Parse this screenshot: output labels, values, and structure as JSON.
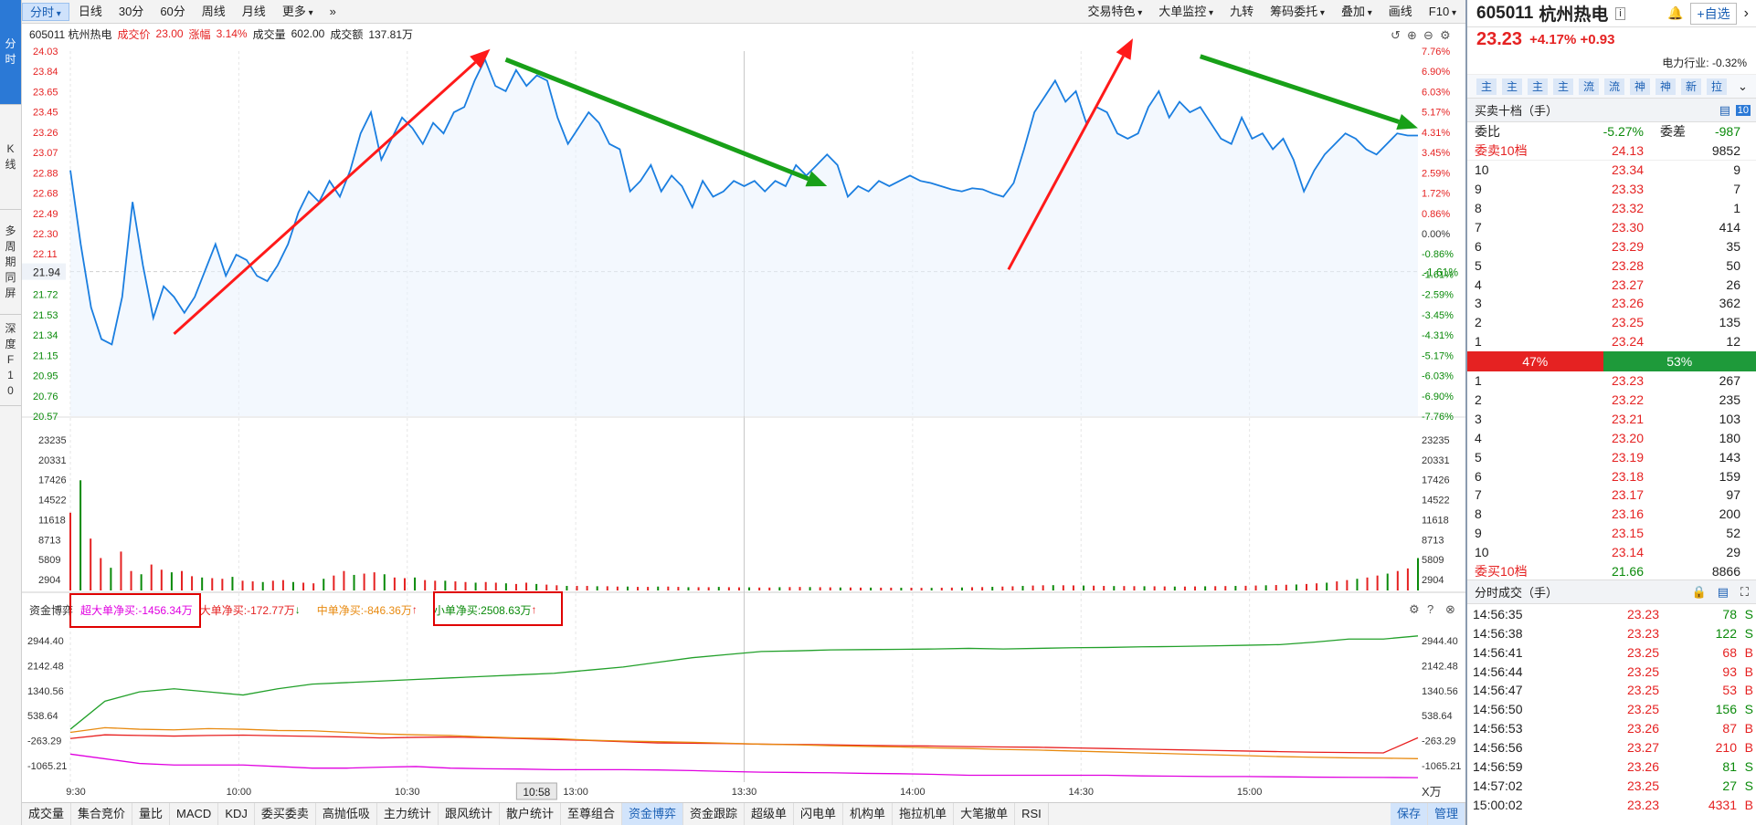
{
  "sidetabs": [
    "分时",
    "K线",
    "多周期同屏",
    "深度F10"
  ],
  "toolbar": {
    "collapse": "»",
    "items": [
      "分时",
      "日线",
      "30分",
      "60分",
      "周线",
      "月线",
      "更多"
    ],
    "right": [
      "交易特色",
      "大单监控",
      "九转",
      "筹码委托",
      "叠加",
      "画线",
      "F10"
    ]
  },
  "info": {
    "code_name": "605011 杭州热电",
    "price_label": "成交价",
    "price": "23.00",
    "change_label": "涨幅",
    "change": "3.14%",
    "vol_label": "成交量",
    "vol": "602.00",
    "amount_label": "成交额",
    "amount": "137.81万"
  },
  "capital_legend": {
    "label": "资金博弈",
    "super": "超大单净买:-1456.34万",
    "large": "大单净买:-172.77万",
    "medium": "中单净买:-846.36万",
    "small": "小单净买:2508.63万"
  },
  "unit_label": "X万",
  "crosshair_time": "10:58",
  "colors": {
    "up": "#e52222",
    "down": "#0a8a0a",
    "price_line": "#1a7ee0",
    "accent": "#2b79d6"
  },
  "chart_data": {
    "type": "line",
    "time_labels": [
      "9:30",
      "10:00",
      "10:30",
      "11:30/13:00",
      "13:30",
      "14:00",
      "14:30",
      "15:00"
    ],
    "prev_close": 21.94,
    "y_ticks_left": [
      "24.03",
      "23.84",
      "23.65",
      "23.45",
      "23.26",
      "23.07",
      "22.88",
      "22.68",
      "22.49",
      "22.30",
      "22.11",
      "21.94",
      "21.72",
      "21.53",
      "21.34",
      "21.15",
      "20.95",
      "20.76",
      "20.57"
    ],
    "y_ticks_right": [
      "7.76%",
      "6.90%",
      "6.03%",
      "5.17%",
      "4.31%",
      "3.45%",
      "2.59%",
      "1.72%",
      "0.86%",
      "0.00%",
      "-0.86%",
      "-1.61%",
      "-2.59%",
      "-3.45%",
      "-4.31%",
      "-5.17%",
      "-6.03%",
      "-6.90%",
      "-7.76%"
    ],
    "vol_ticks": [
      "23235",
      "20331",
      "17426",
      "14522",
      "11618",
      "8713",
      "5809",
      "2904"
    ],
    "cap_ticks": [
      "2944.40",
      "2142.48",
      "1340.56",
      "538.64",
      "-263.29",
      "-1065.21"
    ],
    "price_series": [
      [
        0,
        22.9
      ],
      [
        2,
        22.2
      ],
      [
        4,
        21.6
      ],
      [
        6,
        21.3
      ],
      [
        8,
        21.25
      ],
      [
        10,
        21.7
      ],
      [
        12,
        22.6
      ],
      [
        14,
        22.0
      ],
      [
        16,
        21.5
      ],
      [
        18,
        21.8
      ],
      [
        20,
        21.7
      ],
      [
        22,
        21.55
      ],
      [
        24,
        21.7
      ],
      [
        26,
        21.95
      ],
      [
        28,
        22.2
      ],
      [
        30,
        21.9
      ],
      [
        32,
        22.1
      ],
      [
        34,
        22.05
      ],
      [
        36,
        21.9
      ],
      [
        38,
        21.85
      ],
      [
        40,
        22.0
      ],
      [
        42,
        22.2
      ],
      [
        44,
        22.5
      ],
      [
        46,
        22.7
      ],
      [
        48,
        22.6
      ],
      [
        50,
        22.8
      ],
      [
        52,
        22.65
      ],
      [
        54,
        22.9
      ],
      [
        56,
        23.25
      ],
      [
        58,
        23.45
      ],
      [
        60,
        23.0
      ],
      [
        62,
        23.2
      ],
      [
        64,
        23.4
      ],
      [
        66,
        23.3
      ],
      [
        68,
        23.15
      ],
      [
        70,
        23.35
      ],
      [
        72,
        23.25
      ],
      [
        74,
        23.45
      ],
      [
        76,
        23.5
      ],
      [
        78,
        23.75
      ],
      [
        80,
        23.95
      ],
      [
        82,
        23.7
      ],
      [
        84,
        23.65
      ],
      [
        86,
        23.85
      ],
      [
        88,
        23.7
      ],
      [
        90,
        23.8
      ],
      [
        92,
        23.75
      ],
      [
        94,
        23.4
      ],
      [
        96,
        23.15
      ],
      [
        98,
        23.3
      ],
      [
        100,
        23.45
      ],
      [
        102,
        23.35
      ],
      [
        104,
        23.15
      ],
      [
        106,
        23.1
      ],
      [
        108,
        22.7
      ],
      [
        110,
        22.8
      ],
      [
        112,
        22.95
      ],
      [
        114,
        22.7
      ],
      [
        116,
        22.85
      ],
      [
        118,
        22.75
      ],
      [
        120,
        22.55
      ],
      [
        122,
        22.8
      ],
      [
        124,
        22.65
      ],
      [
        126,
        22.7
      ],
      [
        128,
        22.8
      ],
      [
        130,
        22.75
      ],
      [
        132,
        22.8
      ],
      [
        134,
        22.7
      ],
      [
        136,
        22.8
      ],
      [
        138,
        22.75
      ],
      [
        140,
        22.95
      ],
      [
        142,
        22.85
      ],
      [
        144,
        22.95
      ],
      [
        146,
        23.05
      ],
      [
        148,
        22.95
      ],
      [
        150,
        22.65
      ],
      [
        152,
        22.75
      ],
      [
        154,
        22.7
      ],
      [
        156,
        22.8
      ],
      [
        158,
        22.75
      ],
      [
        160,
        22.8
      ],
      [
        162,
        22.85
      ],
      [
        164,
        22.8
      ],
      [
        166,
        22.78
      ],
      [
        168,
        22.75
      ],
      [
        170,
        22.72
      ],
      [
        172,
        22.7
      ],
      [
        174,
        22.73
      ],
      [
        176,
        22.72
      ],
      [
        178,
        22.68
      ],
      [
        180,
        22.65
      ],
      [
        182,
        22.78
      ],
      [
        184,
        23.1
      ],
      [
        186,
        23.45
      ],
      [
        188,
        23.6
      ],
      [
        190,
        23.75
      ],
      [
        192,
        23.55
      ],
      [
        194,
        23.65
      ],
      [
        196,
        23.35
      ],
      [
        198,
        23.5
      ],
      [
        200,
        23.45
      ],
      [
        202,
        23.25
      ],
      [
        204,
        23.2
      ],
      [
        206,
        23.25
      ],
      [
        208,
        23.5
      ],
      [
        210,
        23.65
      ],
      [
        212,
        23.4
      ],
      [
        214,
        23.55
      ],
      [
        216,
        23.45
      ],
      [
        218,
        23.5
      ],
      [
        220,
        23.35
      ],
      [
        222,
        23.2
      ],
      [
        224,
        23.15
      ],
      [
        226,
        23.4
      ],
      [
        228,
        23.2
      ],
      [
        230,
        23.25
      ],
      [
        232,
        23.1
      ],
      [
        234,
        23.2
      ],
      [
        236,
        23.0
      ],
      [
        238,
        22.7
      ],
      [
        240,
        22.9
      ],
      [
        242,
        23.05
      ],
      [
        244,
        23.15
      ],
      [
        246,
        23.25
      ],
      [
        248,
        23.2
      ],
      [
        250,
        23.1
      ],
      [
        252,
        23.05
      ],
      [
        254,
        23.15
      ],
      [
        256,
        23.25
      ],
      [
        258,
        23.23
      ],
      [
        260,
        23.23
      ]
    ],
    "volume": [
      12000,
      17000,
      8000,
      5000,
      3500,
      6000,
      3000,
      2500,
      4000,
      3200,
      2800,
      3000,
      2200,
      2000,
      1900,
      1800,
      2100,
      1500,
      1400,
      1300,
      1500,
      1600,
      1300,
      1200,
      1100,
      1800,
      2300,
      3000,
      2400,
      2600,
      2800,
      2500,
      2000,
      1900,
      2000,
      1600,
      1500,
      1500,
      1400,
      1300,
      1200,
      1300,
      1200,
      1100,
      1000,
      1200,
      1000,
      900,
      800,
      700,
      700,
      700,
      650,
      650,
      600,
      600,
      550,
      550,
      600,
      600,
      550,
      500,
      500,
      500,
      550,
      500,
      480,
      480,
      450,
      450,
      500,
      520,
      540,
      520,
      500,
      480,
      460,
      460,
      440,
      440,
      430,
      430,
      420,
      420,
      400,
      400,
      420,
      440,
      460,
      500,
      520,
      560,
      600,
      640,
      700,
      760,
      800,
      820,
      800,
      780,
      760,
      740,
      700,
      680,
      680,
      660,
      650,
      640,
      620,
      600,
      600,
      620,
      640,
      660,
      680,
      700,
      720,
      760,
      800,
      840,
      880,
      920,
      1000,
      1100,
      1200,
      1400,
      1600,
      1800,
      2000,
      2300,
      2600,
      3000,
      3400,
      5000
    ],
    "capital_series": [
      {
        "name": "超大单净买",
        "color": "#e000e0",
        "values": [
          -700,
          -850,
          -1000,
          -1050,
          -1050,
          -1050,
          -1100,
          -1150,
          -1150,
          -1120,
          -1100,
          -1150,
          -1170,
          -1180,
          -1200,
          -1200,
          -1200,
          -1210,
          -1230,
          -1260,
          -1280,
          -1290,
          -1300,
          -1320,
          -1330,
          -1350,
          -1380,
          -1380,
          -1380,
          -1380,
          -1380,
          -1400,
          -1410,
          -1420,
          -1420,
          -1430,
          -1440,
          -1445,
          -1450,
          -1456
        ]
      },
      {
        "name": "大单净买",
        "color": "#e82020",
        "values": [
          -200,
          -80,
          -100,
          -120,
          -100,
          -90,
          -110,
          -130,
          -150,
          -180,
          -160,
          -150,
          -170,
          -200,
          -230,
          -260,
          -300,
          -340,
          -350,
          -360,
          -380,
          -390,
          -400,
          -420,
          -430,
          -440,
          -460,
          -470,
          -480,
          -500,
          -520,
          -540,
          -560,
          -580,
          -600,
          -620,
          -640,
          -650,
          -660,
          -173
        ]
      },
      {
        "name": "中单净买",
        "color": "#e88a10",
        "values": [
          0,
          150,
          100,
          80,
          120,
          100,
          60,
          50,
          0,
          -50,
          -80,
          -100,
          -150,
          -180,
          -200,
          -250,
          -280,
          -300,
          -320,
          -350,
          -380,
          -400,
          -430,
          -450,
          -470,
          -500,
          -520,
          -550,
          -570,
          -600,
          -630,
          -660,
          -690,
          -720,
          -750,
          -780,
          -800,
          -820,
          -830,
          -846
        ]
      },
      {
        "name": "小单净买",
        "color": "#22a02a",
        "values": [
          100,
          1000,
          1300,
          1400,
          1300,
          1200,
          1400,
          1550,
          1600,
          1650,
          1700,
          1750,
          1800,
          1850,
          1900,
          2000,
          2100,
          2250,
          2400,
          2500,
          2600,
          2620,
          2650,
          2660,
          2670,
          2680,
          2700,
          2680,
          2700,
          2720,
          2730,
          2750,
          2760,
          2780,
          2800,
          2820,
          2900,
          3000,
          3000,
          3100
        ]
      }
    ],
    "arrows": [
      {
        "dir": "up",
        "color": "#ff1a1a",
        "from": [
          20,
          21.35
        ],
        "to": [
          81,
          24.05
        ]
      },
      {
        "dir": "down",
        "color": "#18a018",
        "from": [
          84,
          23.95
        ],
        "to": [
          146,
          22.75
        ]
      },
      {
        "dir": "up",
        "color": "#ff1a1a",
        "from": [
          181,
          21.96
        ],
        "to": [
          205,
          24.15
        ]
      },
      {
        "dir": "down",
        "color": "#18a018",
        "from": [
          218,
          23.98
        ],
        "to": [
          260,
          23.3
        ]
      }
    ]
  },
  "bottom_tabs": [
    "成交量",
    "集合竞价",
    "量比",
    "MACD",
    "KDJ",
    "委买委卖",
    "高抛低吸",
    "主力统计",
    "跟风统计",
    "散户统计",
    "至尊组合",
    "资金博弈",
    "资金跟踪",
    "超级单",
    "闪电单",
    "机构单",
    "拖拉机单",
    "大笔撤单",
    "RSI"
  ],
  "bottom_right": [
    "保存",
    "管理"
  ],
  "right": {
    "code": "605011",
    "name": "杭州热电",
    "price": "23.23",
    "change": "+4.17% +0.93",
    "industry": "电力行业: -0.32%",
    "self_select": "+自选",
    "tags": [
      "主",
      "主",
      "主",
      "主",
      "流",
      "流",
      "神",
      "神",
      "新",
      "拉"
    ],
    "orderbook_title": "买卖十档（手）",
    "wb_label": "委比",
    "wb": "-5.27%",
    "wc_label": "委差",
    "wc": "-987",
    "sell10_label": "委卖10档",
    "sell10_price": "24.13",
    "sell10_vol": "9852",
    "asks": [
      [
        "10",
        "23.34",
        "9"
      ],
      [
        "9",
        "23.33",
        "7"
      ],
      [
        "8",
        "23.32",
        "1"
      ],
      [
        "7",
        "23.30",
        "414"
      ],
      [
        "6",
        "23.29",
        "35"
      ],
      [
        "5",
        "23.28",
        "50"
      ],
      [
        "4",
        "23.27",
        "26"
      ],
      [
        "3",
        "23.26",
        "362"
      ],
      [
        "2",
        "23.25",
        "135"
      ],
      [
        "1",
        "23.24",
        "12"
      ]
    ],
    "ratio": [
      "47%",
      "53%"
    ],
    "ratio_values": [
      0.47,
      0.53
    ],
    "bids": [
      [
        "1",
        "23.23",
        "267"
      ],
      [
        "2",
        "23.22",
        "235"
      ],
      [
        "3",
        "23.21",
        "103"
      ],
      [
        "4",
        "23.20",
        "180"
      ],
      [
        "5",
        "23.19",
        "143"
      ],
      [
        "6",
        "23.18",
        "159"
      ],
      [
        "7",
        "23.17",
        "97"
      ],
      [
        "8",
        "23.16",
        "200"
      ],
      [
        "9",
        "23.15",
        "52"
      ],
      [
        "10",
        "23.14",
        "29"
      ]
    ],
    "buy10_label": "委买10档",
    "buy10_price": "21.66",
    "buy10_vol": "8866",
    "ticks_title": "分时成交（手）",
    "ticks": [
      [
        "14:56:35",
        "23.23",
        "78",
        "S"
      ],
      [
        "14:56:38",
        "23.23",
        "122",
        "S"
      ],
      [
        "14:56:41",
        "23.25",
        "68",
        "B"
      ],
      [
        "14:56:44",
        "23.25",
        "93",
        "B"
      ],
      [
        "14:56:47",
        "23.25",
        "53",
        "B"
      ],
      [
        "14:56:50",
        "23.25",
        "156",
        "S"
      ],
      [
        "14:56:53",
        "23.26",
        "87",
        "B"
      ],
      [
        "14:56:56",
        "23.27",
        "210",
        "B"
      ],
      [
        "14:56:59",
        "23.26",
        "81",
        "S"
      ],
      [
        "14:57:02",
        "23.25",
        "27",
        "S"
      ],
      [
        "15:00:02",
        "23.23",
        "4331",
        "B"
      ]
    ]
  }
}
